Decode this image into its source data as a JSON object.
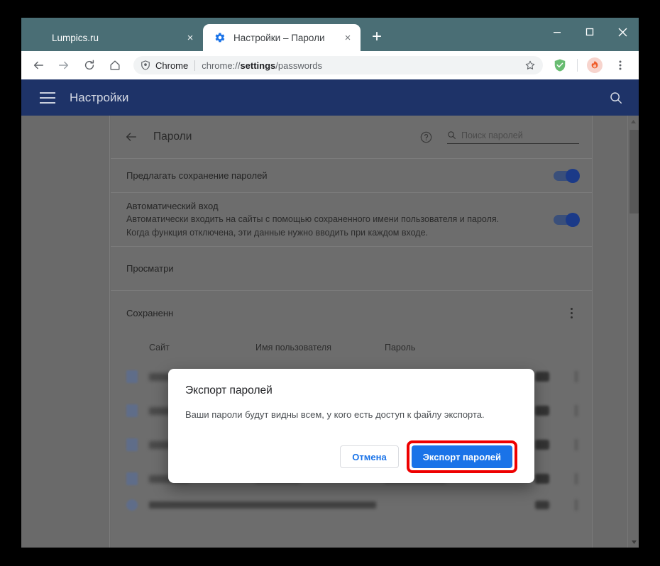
{
  "browser": {
    "tabs": [
      {
        "title": "Lumpics.ru",
        "favicon": "orange-circle-icon",
        "active": false,
        "close_label": "×"
      },
      {
        "title": "Настройки – Пароли",
        "favicon": "gear-icon",
        "active": true,
        "close_label": "×"
      }
    ],
    "new_tab_label": "+",
    "window_controls": {
      "minimize": "—",
      "maximize": "☐",
      "close": "✕"
    },
    "toolbar": {
      "back": "←",
      "forward": "→",
      "reload": "↻",
      "home": "⌂",
      "omnibox": {
        "security_chip": "Chrome",
        "url_prefix": "chrome://",
        "url_bold": "settings",
        "url_suffix": "/passwords",
        "full_url": "chrome://settings/passwords"
      },
      "bookmark_star": "☆",
      "extension_name": "adguard-shield-icon",
      "profile_avatar": "profile-avatar",
      "menu": "⋮"
    }
  },
  "settings_bar": {
    "menu_label": "hamburger-icon",
    "title": "Настройки",
    "search_label": "search-icon"
  },
  "passwords_page": {
    "back_label": "←",
    "title": "Пароли",
    "help_label": "help-icon",
    "search_placeholder": "Поиск паролей",
    "rows": {
      "offer_save": "Предлагать сохранение паролей",
      "auto_signin_title": "Автоматический вход",
      "auto_signin_desc_1": "Автоматически входить на сайты с помощью сохраненного имени пользователя и пароля.",
      "auto_signin_desc_2": "Когда функция отключена, эти данные нужно вводить при каждом входе.",
      "view_label": "Просматри",
      "saved_label": "Сохраненн"
    },
    "table": {
      "headers": [
        "Сайт",
        "Имя пользователя",
        "Пароль"
      ],
      "rows": [
        {
          "user_w": 148,
          "pass_w": 56
        },
        {
          "user_w": 148,
          "pass_w": 56
        },
        {
          "user_w": 62,
          "pass_w": 86
        },
        {
          "user_w": 62,
          "pass_w": 86
        }
      ]
    }
  },
  "dialog": {
    "title": "Экспорт паролей",
    "body": "Ваши пароли будут видны всем, у кого есть доступ к файлу экспорта.",
    "cancel_label": "Отмена",
    "export_label": "Экспорт паролей"
  },
  "colors": {
    "tabstrip": "#4a6e75",
    "settings_bar": "#1e3368",
    "accent_blue": "#1a73e8",
    "highlight_red": "#ee0000",
    "overlay_gray": "#6d6d6d"
  }
}
